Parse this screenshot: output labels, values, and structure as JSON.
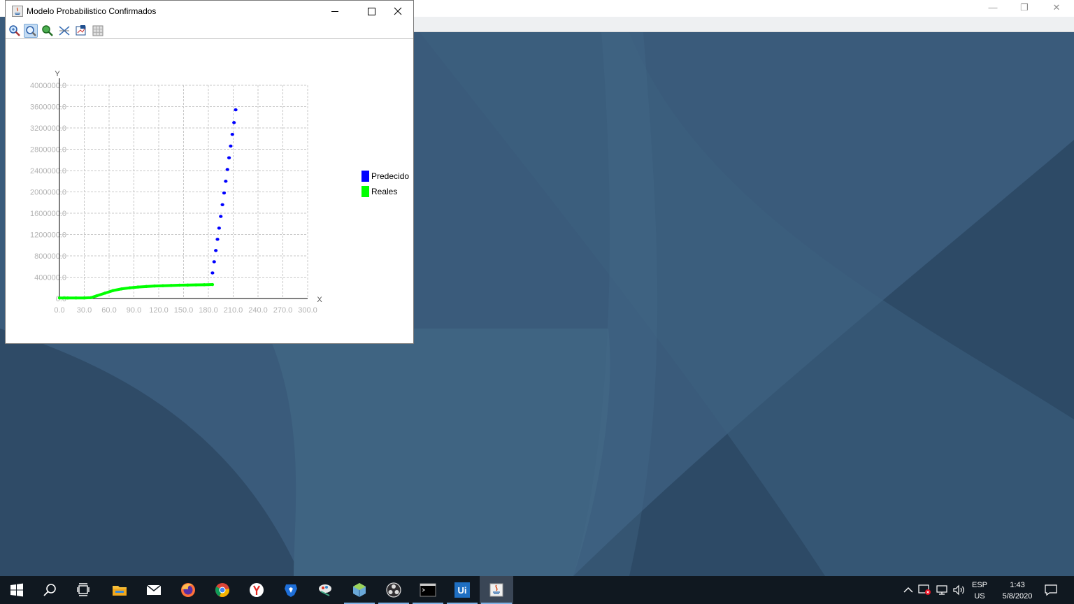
{
  "window": {
    "title": "Modelo Probabilistico Confirmados",
    "toolbar_icons": [
      "zoom-in-icon",
      "zoom-icon",
      "zoom-out-icon",
      "scale-icon",
      "export-icon",
      "grid-toggle-icon"
    ]
  },
  "chart_data": {
    "type": "scatter",
    "title": "",
    "xlabel": "X",
    "ylabel": "Y",
    "xlim": [
      0,
      300
    ],
    "ylim": [
      0,
      4000000
    ],
    "xticks": [
      "0.0",
      "30.0",
      "60.0",
      "90.0",
      "120.0",
      "150.0",
      "180.0",
      "210.0",
      "240.0",
      "270.0",
      "300.0"
    ],
    "yticks": [
      "0.0",
      "400000.0",
      "800000.0",
      "1200000.0",
      "1600000.0",
      "2000000.0",
      "2400000.0",
      "2800000.0",
      "3200000.0",
      "3600000.0",
      "4000000.0"
    ],
    "grid": true,
    "legend_position": "right",
    "series": [
      {
        "name": "Predecido",
        "color": "#0000ff",
        "points": [
          [
            185,
            480000
          ],
          [
            187,
            690000
          ],
          [
            189,
            900000
          ],
          [
            191,
            1110000
          ],
          [
            193,
            1320000
          ],
          [
            195,
            1540000
          ],
          [
            197,
            1760000
          ],
          [
            199,
            1980000
          ],
          [
            201,
            2200000
          ],
          [
            203,
            2420000
          ],
          [
            205,
            2640000
          ],
          [
            207,
            2860000
          ],
          [
            209,
            3080000
          ],
          [
            211,
            3300000
          ],
          [
            213,
            3540000
          ]
        ]
      },
      {
        "name": "Reales",
        "color": "#00ff00",
        "points": [
          [
            0,
            10000
          ],
          [
            10,
            10000
          ],
          [
            20,
            10000
          ],
          [
            30,
            10000
          ],
          [
            38,
            15000
          ],
          [
            45,
            50000
          ],
          [
            55,
            100000
          ],
          [
            65,
            150000
          ],
          [
            75,
            180000
          ],
          [
            85,
            200000
          ],
          [
            95,
            215000
          ],
          [
            105,
            225000
          ],
          [
            115,
            235000
          ],
          [
            125,
            240000
          ],
          [
            135,
            245000
          ],
          [
            145,
            250000
          ],
          [
            155,
            252000
          ],
          [
            165,
            255000
          ],
          [
            175,
            258000
          ],
          [
            185,
            262000
          ]
        ]
      }
    ]
  },
  "tray": {
    "lang_top": "ESP",
    "lang_bottom": "US",
    "time": "1:43",
    "date": "5/8/2020"
  },
  "taskbar_icons": [
    "start-icon",
    "search-icon",
    "task-view-icon",
    "file-explorer-icon",
    "mail-icon",
    "firefox-icon",
    "chrome-icon",
    "yandex-icon",
    "brave-icon",
    "app-icon",
    "virtualbox-icon",
    "obs-icon",
    "terminal-icon",
    "uipath-icon",
    "java-icon"
  ]
}
